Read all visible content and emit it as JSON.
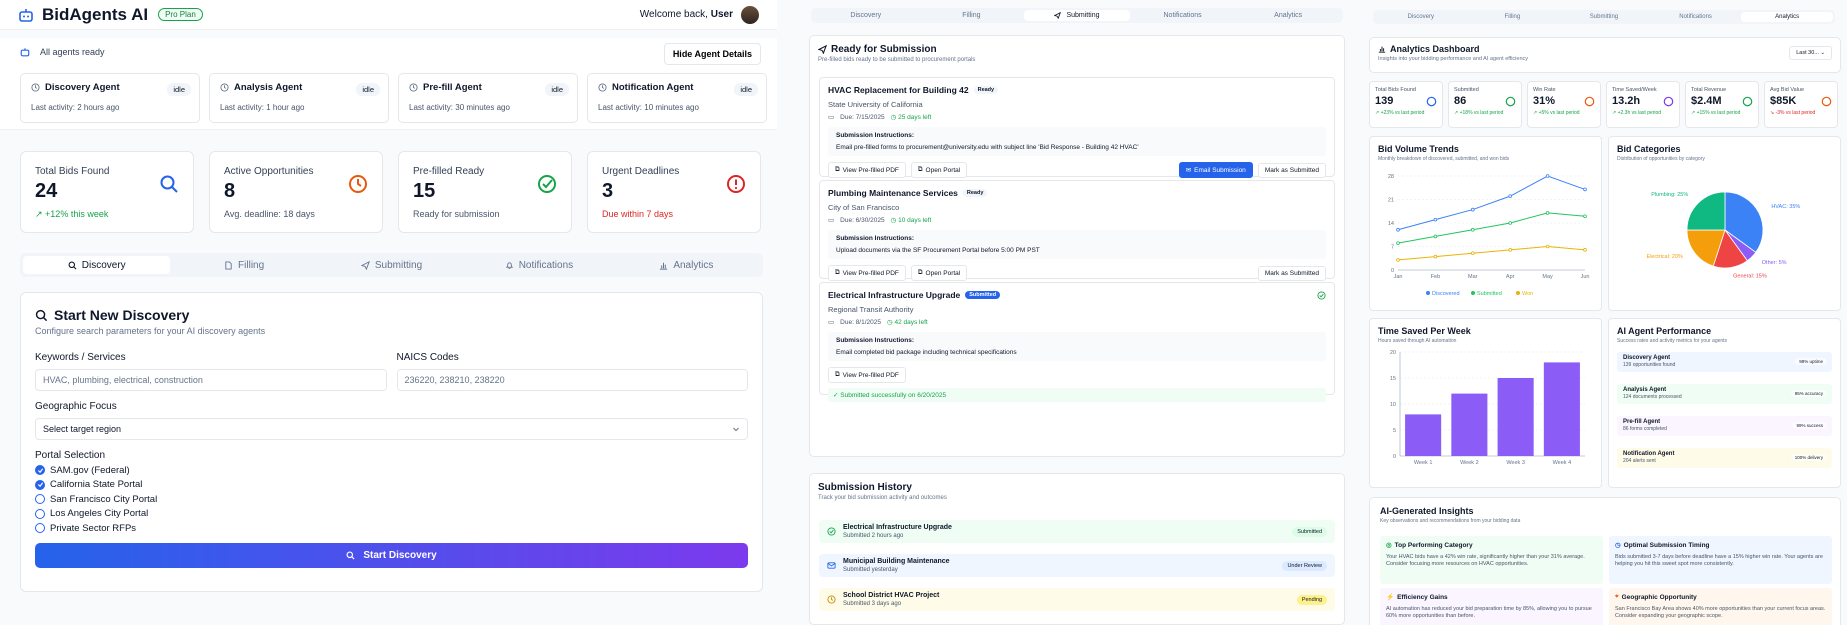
{
  "app": {
    "brand": "BidAgents AI",
    "plan": "Pro Plan",
    "welcome_prefix": "Welcome back,",
    "user": "User",
    "agents_status": "All agents ready",
    "hide_details": "Hide Agent Details"
  },
  "agents": [
    {
      "name": "Discovery Agent",
      "status": "idle",
      "activity": "Last activity: 2 hours ago"
    },
    {
      "name": "Analysis Agent",
      "status": "idle",
      "activity": "Last activity: 1 hour ago"
    },
    {
      "name": "Pre-fill Agent",
      "status": "idle",
      "activity": "Last activity: 30 minutes ago"
    },
    {
      "name": "Notification Agent",
      "status": "idle",
      "activity": "Last activity: 10 minutes ago"
    }
  ],
  "stats": [
    {
      "label": "Total Bids Found",
      "value": "24",
      "sub": "+12% this week",
      "color": "#2563eb"
    },
    {
      "label": "Active Opportunities",
      "value": "8",
      "sub": "Avg. deadline: 18 days",
      "color": "#ea580c"
    },
    {
      "label": "Pre-filled Ready",
      "value": "15",
      "sub": "Ready for submission",
      "color": "#16a34a"
    },
    {
      "label": "Urgent Deadlines",
      "value": "3",
      "sub": "Due within 7 days",
      "color": "#dc2626"
    }
  ],
  "tabs": [
    "Discovery",
    "Filling",
    "Submitting",
    "Notifications",
    "Analytics"
  ],
  "discovery": {
    "title": "Start New Discovery",
    "subtitle": "Configure search parameters for your AI discovery agents",
    "keywords_label": "Keywords / Services",
    "keywords_placeholder": "HVAC, plumbing, electrical, construction",
    "naics_label": "NAICS Codes",
    "naics_placeholder": "236220, 238210, 238220",
    "geo_label": "Geographic Focus",
    "geo_placeholder": "Select target region",
    "portal_label": "Portal Selection",
    "portals": [
      {
        "name": "SAM.gov (Federal)",
        "checked": true
      },
      {
        "name": "California State Portal",
        "checked": true
      },
      {
        "name": "San Francisco City Portal",
        "checked": false
      },
      {
        "name": "Los Angeles City Portal",
        "checked": false
      },
      {
        "name": "Private Sector RFPs",
        "checked": false
      }
    ],
    "start_button": "Start Discovery"
  },
  "submission": {
    "title": "Ready for Submission",
    "subtitle": "Pre-filled bids ready to be submitted to procurement portals",
    "instructions_label": "Submission Instructions:",
    "view_pdf": "View Pre-filled PDF",
    "open_portal": "Open Portal",
    "email_submission": "Email Submission",
    "mark_submitted": "Mark as Submitted",
    "bids": [
      {
        "title": "HVAC Replacement for Building 42",
        "status": "Ready",
        "org": "State University of California",
        "due": "Due: 7/15/2025",
        "left": "25 days left",
        "instructions": "Email pre-filled forms to procurement@university.edu with subject line 'Bid Response - Building 42 HVAC'"
      },
      {
        "title": "Plumbing Maintenance Services",
        "status": "Ready",
        "org": "City of San Francisco",
        "due": "Due: 6/30/2025",
        "left": "10 days left",
        "instructions": "Upload documents via the SF Procurement Portal before 5:00 PM PST"
      },
      {
        "title": "Electrical Infrastructure Upgrade",
        "status": "Submitted",
        "org": "Regional Transit Authority",
        "due": "Due: 8/1/2025",
        "left": "42 days left",
        "instructions": "Email completed bid package including technical specifications",
        "note": "✓ Submitted successfully on 6/20/2025"
      }
    ]
  },
  "history": {
    "title": "Submission History",
    "subtitle": "Track your bid submission activity and outcomes",
    "items": [
      {
        "name": "Electrical Infrastructure Upgrade",
        "when": "Submitted 2 hours ago",
        "status": "Submitted",
        "bg": "#f0fdf4",
        "badge": "#dcfce7"
      },
      {
        "name": "Municipal Building Maintenance",
        "when": "Submitted yesterday",
        "status": "Under Review",
        "bg": "#eff6ff",
        "badge": "#dbeafe"
      },
      {
        "name": "School District HVAC Project",
        "when": "Submitted 3 days ago",
        "status": "Pending",
        "bg": "#fefce8",
        "badge": "#fef08a"
      }
    ]
  },
  "analytics": {
    "title": "Analytics Dashboard",
    "subtitle": "Insights into your bidding performance and AI agent efficiency",
    "range": "Last 30...",
    "kpis": [
      {
        "label": "Total Bids Found",
        "value": "139",
        "change": "+23% vs last period",
        "color": "#2563eb",
        "up": true
      },
      {
        "label": "Submitted",
        "value": "86",
        "change": "+18% vs last period",
        "color": "#16a34a",
        "up": true
      },
      {
        "label": "Win Rate",
        "value": "31%",
        "change": "+5% vs last period",
        "color": "#ea580c",
        "up": true
      },
      {
        "label": "Time Saved/Week",
        "value": "13.2h",
        "change": "+2.3h vs last period",
        "color": "#7c3aed",
        "up": true
      },
      {
        "label": "Total Revenue",
        "value": "$2.4M",
        "change": "+15% vs last period",
        "color": "#16a34a",
        "up": true
      },
      {
        "label": "Avg Bid Value",
        "value": "$85K",
        "change": "-3% vs last period",
        "color": "#ea580c",
        "up": false
      }
    ],
    "trends_title": "Bid Volume Trends",
    "trends_subtitle": "Monthly breakdown of discovered, submitted, and won bids",
    "categories_title": "Bid Categories",
    "categories_subtitle": "Distribution of opportunities by category",
    "time_title": "Time Saved Per Week",
    "time_subtitle": "Hours saved through AI automation",
    "perf_title": "AI Agent Performance",
    "perf_subtitle": "Success rates and activity metrics for your agents",
    "performance": [
      {
        "name": "Discovery Agent",
        "detail": "139 opportunities found",
        "rate": "98% uptime",
        "bg": "#eff6ff"
      },
      {
        "name": "Analysis Agent",
        "detail": "124 documents processed",
        "rate": "95% accuracy",
        "bg": "#f0fdf4"
      },
      {
        "name": "Pre-fill Agent",
        "detail": "86 forms completed",
        "rate": "99% success",
        "bg": "#faf5ff"
      },
      {
        "name": "Notification Agent",
        "detail": "204 alerts sent",
        "rate": "100% delivery",
        "bg": "#fefce8"
      }
    ],
    "insights_title": "AI-Generated Insights",
    "insights_subtitle": "Key observations and recommendations from your bidding data",
    "insights": [
      {
        "title": "Top Performing Category",
        "text": "Your HVAC bids have a 42% win rate, significantly higher than your 31% average. Consider focusing more resources on HVAC opportunities.",
        "bg": "#f0fdf4",
        "color": "#16a34a"
      },
      {
        "title": "Optimal Submission Timing",
        "text": "Bids submitted 3-7 days before deadline have a 15% higher win rate. Your agents are helping you hit this sweet spot more consistently.",
        "bg": "#eff6ff",
        "color": "#2563eb"
      },
      {
        "title": "Efficiency Gains",
        "text": "AI automation has reduced your bid preparation time by 85%, allowing you to pursue 60% more opportunities than before.",
        "bg": "#faf5ff",
        "color": "#7c3aed"
      },
      {
        "title": "Geographic Opportunity",
        "text": "San Francisco Bay Area shows 40% more opportunities than your current focus areas. Consider expanding your geographic scope.",
        "bg": "#fff7ed",
        "color": "#ea580c"
      }
    ]
  },
  "chart_data": [
    {
      "type": "line",
      "title": "Bid Volume Trends",
      "categories": [
        "Jan",
        "Feb",
        "Mar",
        "Apr",
        "May",
        "Jun"
      ],
      "ylim": [
        0,
        28
      ],
      "yticks": [
        0,
        7,
        14,
        21,
        28
      ],
      "series": [
        {
          "name": "Discovered",
          "color": "#3b82f6",
          "values": [
            12,
            15,
            18,
            22,
            28,
            24
          ]
        },
        {
          "name": "Submitted",
          "color": "#22c55e",
          "values": [
            8,
            10,
            12,
            14,
            17,
            16
          ]
        },
        {
          "name": "Won",
          "color": "#eab308",
          "values": [
            3,
            4,
            5,
            6,
            7,
            6
          ]
        }
      ]
    },
    {
      "type": "pie",
      "title": "Bid Categories",
      "slices": [
        {
          "name": "HVAC",
          "value": 35,
          "label": "HVAC: 35%",
          "color": "#3b82f6"
        },
        {
          "name": "Other",
          "value": 5,
          "label": "Other: 5%",
          "color": "#8b5cf6"
        },
        {
          "name": "General",
          "value": 15,
          "label": "General: 15%",
          "color": "#ef4444"
        },
        {
          "name": "Electrical",
          "value": 20,
          "label": "Electrical: 20%",
          "color": "#f59e0b"
        },
        {
          "name": "Plumbing",
          "value": 25,
          "label": "Plumbing: 25%",
          "color": "#10b981"
        }
      ]
    },
    {
      "type": "bar",
      "title": "Time Saved Per Week",
      "categories": [
        "Week 1",
        "Week 2",
        "Week 3",
        "Week 4"
      ],
      "values": [
        8,
        12,
        15,
        18
      ],
      "ylim": [
        0,
        20
      ],
      "yticks": [
        0,
        5,
        10,
        15,
        20
      ],
      "color": "#8b5cf6"
    }
  ]
}
